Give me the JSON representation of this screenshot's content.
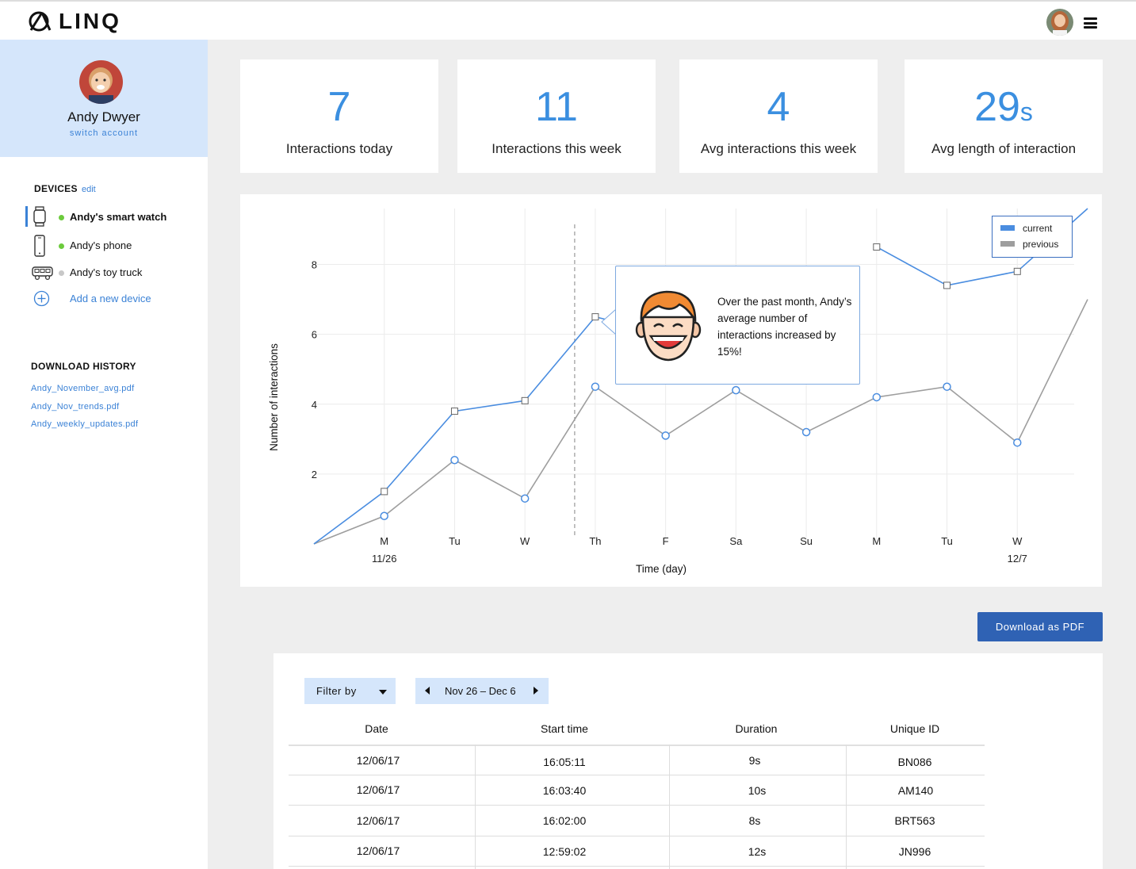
{
  "app": {
    "name": "LINQ"
  },
  "profile": {
    "name": "Andy Dwyer",
    "switch_label": "switch account"
  },
  "devices": {
    "title": "DEVICES",
    "edit_label": "edit",
    "items": [
      {
        "label": "Andy's smart watch",
        "status": "online",
        "icon": "watch-icon",
        "active": true
      },
      {
        "label": "Andy's phone",
        "status": "online",
        "icon": "phone-icon",
        "active": false
      },
      {
        "label": "Andy's toy truck",
        "status": "offline",
        "icon": "truck-icon",
        "active": false
      }
    ],
    "add_label": "Add a new device"
  },
  "download_history": {
    "title": "DOWNLOAD HISTORY",
    "files": [
      "Andy_November_avg.pdf",
      "Andy_Nov_trends.pdf",
      "Andy_weekly_updates.pdf"
    ]
  },
  "stats": [
    {
      "value": "7",
      "unit": "",
      "label": "Interactions today"
    },
    {
      "value": "11",
      "unit": "",
      "label": "Interactions this week"
    },
    {
      "value": "4",
      "unit": "",
      "label": "Avg interactions this week"
    },
    {
      "value": "29",
      "unit": "s",
      "label": "Avg length of interaction"
    }
  ],
  "colors": {
    "accent": "#3b8fe0",
    "current": "#4a8de0",
    "previous": "#9e9e9e",
    "button": "#2f62b4",
    "highlight": "#d5e6fb",
    "online": "#6ccb3d",
    "offline": "#c8c8c8"
  },
  "chart_data": {
    "type": "line",
    "xlabel": "Time (day)",
    "ylabel": "Number of interactions",
    "ylim": [
      0,
      9.6
    ],
    "yticks": [
      2,
      4,
      6,
      8
    ],
    "categories": [
      "",
      "M",
      "Tu",
      "W",
      "Th",
      "F",
      "Sa",
      "Su",
      "M",
      "Tu",
      "W",
      ""
    ],
    "category_dates": [
      "",
      "11/26",
      "",
      "",
      "",
      "",
      "",
      "",
      "",
      "",
      "12/7",
      ""
    ],
    "grid": true,
    "legend_position": "top-right",
    "highlight_category": "Th",
    "series": [
      {
        "name": "current",
        "color": "#4a8de0",
        "marker": "square",
        "values": [
          0,
          1.5,
          3.8,
          4.1,
          6.5,
          6.0,
          null,
          null,
          8.5,
          7.4,
          7.8,
          10
        ]
      },
      {
        "name": "previous",
        "color": "#9e9e9e",
        "marker": "circle",
        "values": [
          0,
          0.8,
          2.4,
          1.3,
          4.5,
          3.1,
          4.4,
          3.2,
          4.2,
          4.5,
          2.9,
          7.0
        ]
      }
    ],
    "annotation": "Over the past month, Andy’s average number of interactions increased by 15%!"
  },
  "download_button": {
    "label": "Download as PDF"
  },
  "table": {
    "filter_label": "Filter by",
    "date_range": "Nov 26 – Dec 6",
    "columns": [
      "Date",
      "Start time",
      "Duration",
      "Unique ID"
    ],
    "rows": [
      [
        "12/06/17",
        "16:05:11",
        "9s",
        "BN086"
      ],
      [
        "12/06/17",
        "16:03:40",
        "10s",
        "AM140"
      ],
      [
        "12/06/17",
        "16:02:00",
        "8s",
        "BRT563"
      ],
      [
        "12/06/17",
        "12:59:02",
        "12s",
        "JN996"
      ]
    ]
  }
}
